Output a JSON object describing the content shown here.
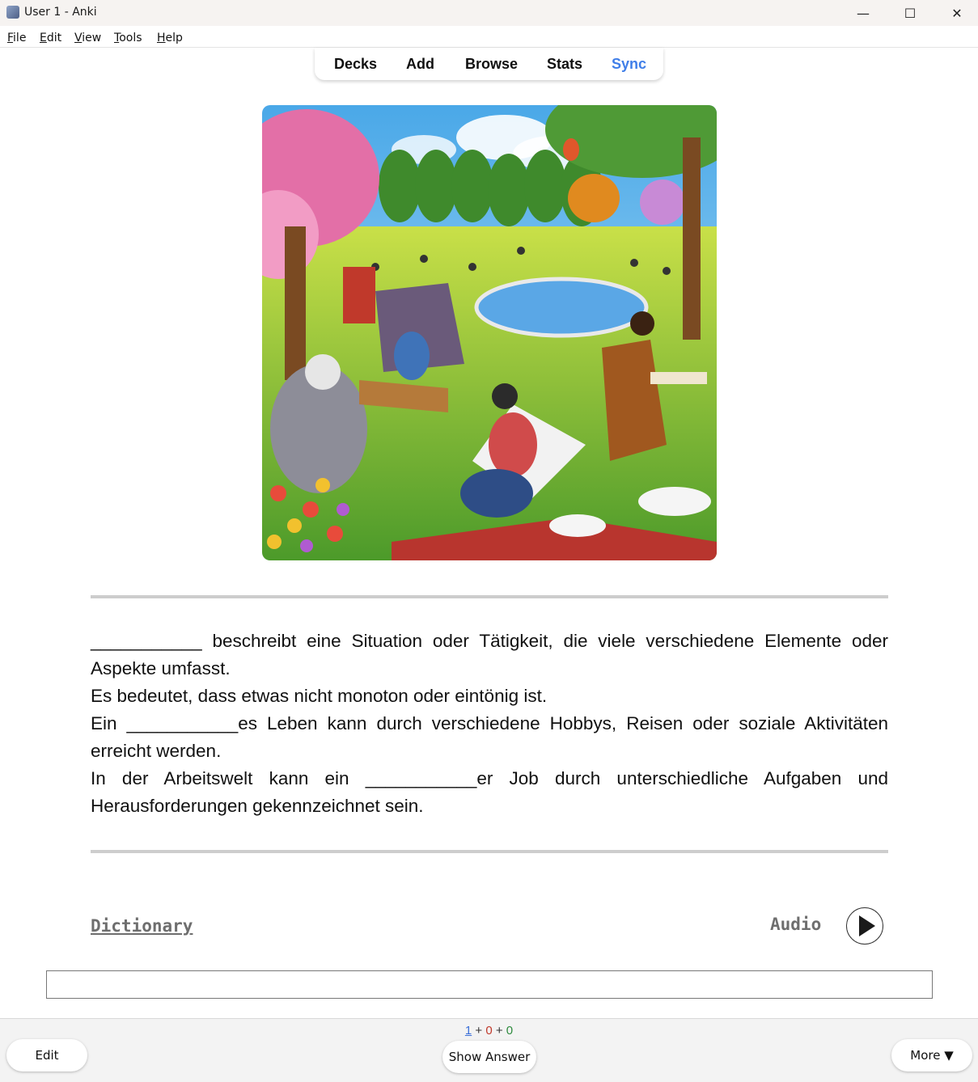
{
  "window": {
    "title": "User 1 - Anki",
    "minimize": "—",
    "maximize": "☐",
    "close": "✕"
  },
  "menu": [
    {
      "key": "F",
      "rest": "ile"
    },
    {
      "key": "E",
      "rest": "dit"
    },
    {
      "key": "V",
      "rest": "iew"
    },
    {
      "key": "T",
      "rest": "ools"
    },
    {
      "key": "H",
      "rest": "elp"
    }
  ],
  "toolbar": {
    "decks": "Decks",
    "add": "Add",
    "browse": "Browse",
    "stats": "Stats",
    "sync": "Sync"
  },
  "card": {
    "lines": [
      "___________ beschreibt eine Situation oder Tätigkeit, die viele verschiedene Elemente oder Aspekte umfasst.",
      "Es bedeutet, dass etwas nicht monoton oder eintönig ist.",
      "Ein ___________es Leben kann durch verschiedene Hobbys, Reisen oder soziale Aktivitäten erreicht werden.",
      "In der Arbeitswelt kann ein ___________er Job durch unterschiedliche Aufgaben und Herausforderungen gekennzeichnet sein."
    ],
    "dictionary": "Dictionary",
    "audio": "Audio"
  },
  "counts": {
    "new": "1",
    "plus1": "+",
    "learn": "0",
    "plus2": "+",
    "review": "0"
  },
  "bottom": {
    "edit": "Edit",
    "show_answer": "Show Answer",
    "more": "More ▼"
  },
  "colors": {
    "sync": "#3f7ee8",
    "new": "#3b6fd8",
    "learn": "#c0392b",
    "review": "#2e8b3e"
  }
}
